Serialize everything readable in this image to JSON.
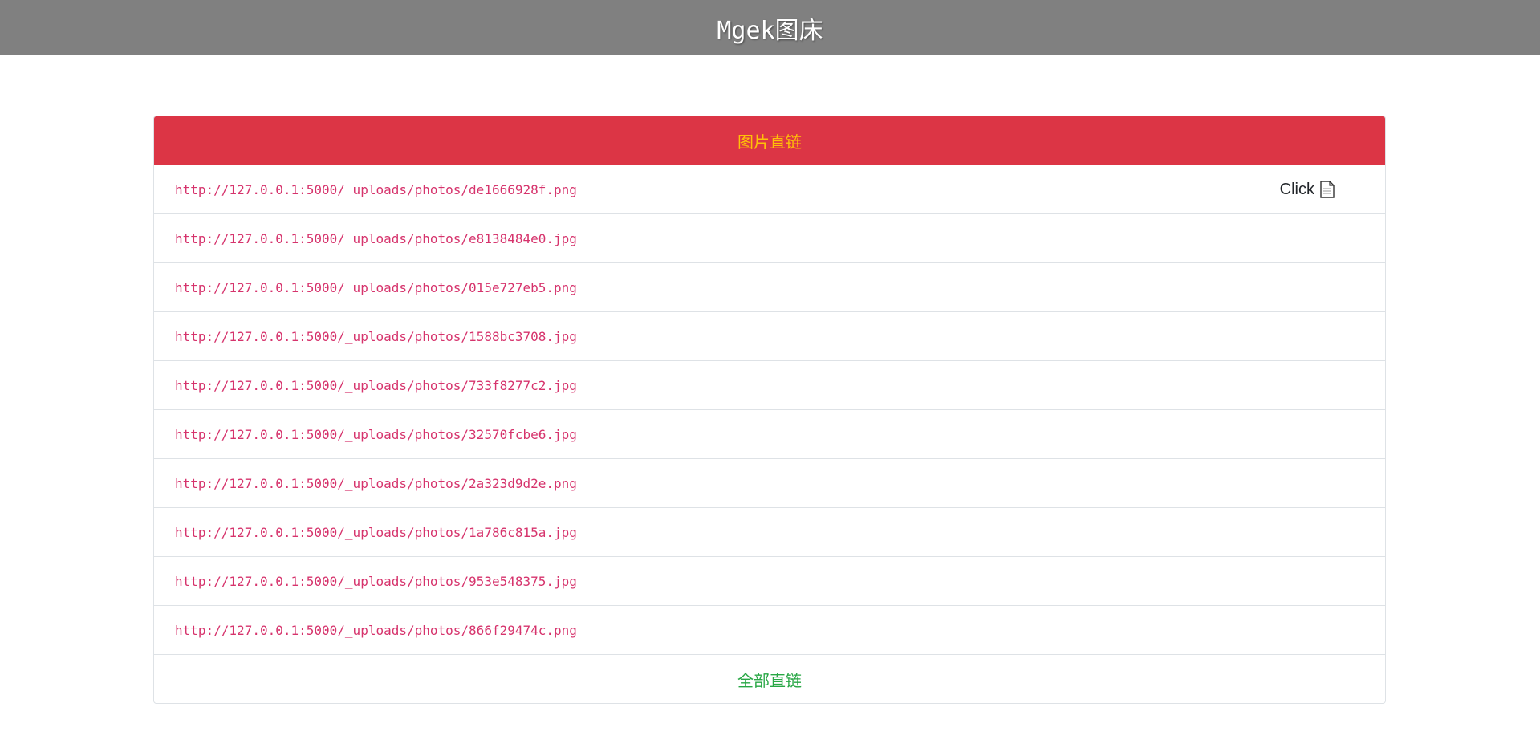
{
  "header": {
    "title": "Mgek图床"
  },
  "panel": {
    "header_label": "图片直链",
    "copy_label": "Click",
    "links": [
      "http://127.0.0.1:5000/_uploads/photos/de1666928f.png",
      "http://127.0.0.1:5000/_uploads/photos/e8138484e0.jpg",
      "http://127.0.0.1:5000/_uploads/photos/015e727eb5.png",
      "http://127.0.0.1:5000/_uploads/photos/1588bc3708.jpg",
      "http://127.0.0.1:5000/_uploads/photos/733f8277c2.jpg",
      "http://127.0.0.1:5000/_uploads/photos/32570fcbe6.jpg",
      "http://127.0.0.1:5000/_uploads/photos/2a323d9d2e.png",
      "http://127.0.0.1:5000/_uploads/photos/1a786c815a.jpg",
      "http://127.0.0.1:5000/_uploads/photos/953e548375.jpg",
      "http://127.0.0.1:5000/_uploads/photos/866f29474c.png"
    ],
    "footer_label": "全部直链"
  },
  "colors": {
    "topbar": "#808080",
    "panel_header_bg": "#dc3545",
    "panel_header_text": "#ffc107",
    "link_text": "#d6336c",
    "footer_text": "#28a745"
  },
  "icons": {
    "copy": "document-icon"
  }
}
